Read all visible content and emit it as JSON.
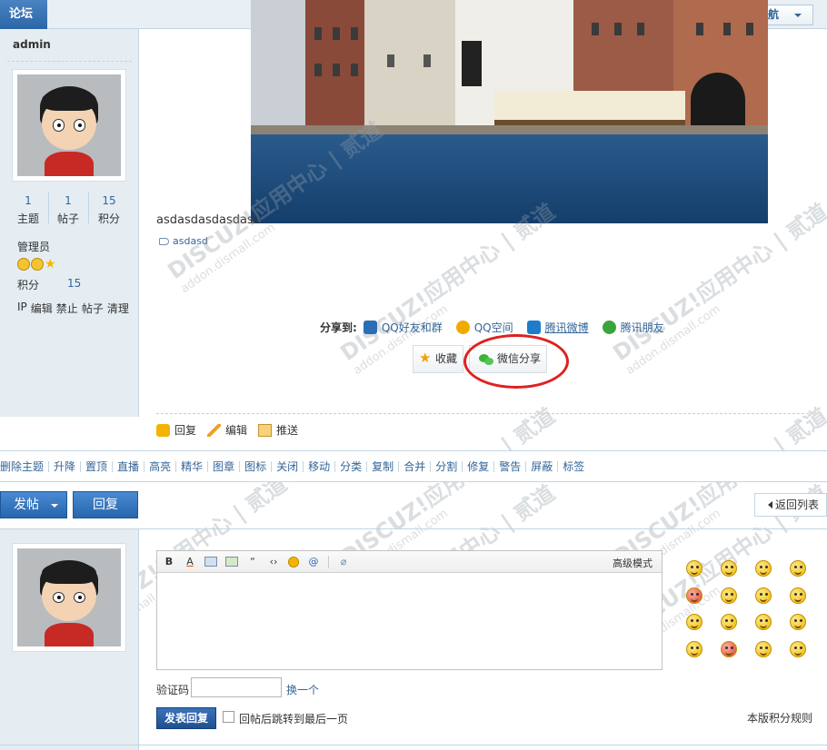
{
  "topbar": {
    "forum_tab": "论坛",
    "quick_nav": "快捷导航"
  },
  "user": {
    "name": "admin",
    "stats": [
      {
        "value": "1",
        "label": "主题"
      },
      {
        "value": "1",
        "label": "帖子"
      },
      {
        "value": "15",
        "label": "积分"
      }
    ],
    "group": "管理员",
    "points_label": "积分",
    "points_value": "15",
    "admin_links": [
      "IP",
      "编辑",
      "禁止",
      "帖子",
      "清理"
    ]
  },
  "post": {
    "text": "asdasdasdasdasd",
    "tag": "asdasd",
    "share": {
      "label": "分享到:",
      "items": [
        {
          "label": "QQ好友和群",
          "icon": "qq-icon",
          "color": "#2a6fb5"
        },
        {
          "label": "QQ空间",
          "icon": "qzone-icon",
          "color": "#f2a900"
        },
        {
          "label": "腾讯微博",
          "icon": "tencent-weibo-icon",
          "color": "#1d7dcc"
        },
        {
          "label": "腾讯朋友",
          "icon": "tencent-friend-icon",
          "color": "#3aa53a"
        }
      ]
    },
    "favorite": "收藏",
    "wechat_share": "微信分享",
    "actions": [
      "回复",
      "编辑",
      "推送"
    ]
  },
  "modbar": [
    "删除主题",
    "升降",
    "置顶",
    "直播",
    "高亮",
    "精华",
    "图章",
    "图标",
    "关闭",
    "移动",
    "分类",
    "复制",
    "合并",
    "分割",
    "修复",
    "警告",
    "屏蔽",
    "标签"
  ],
  "buttons": {
    "post": "发帖",
    "reply": "回复",
    "back": "返回列表"
  },
  "editor": {
    "toolbar_tools": [
      "B",
      "A",
      "image-icon",
      "link-icon",
      "quote-icon",
      "code-icon",
      "smiley-icon",
      "at-icon",
      "attach-icon"
    ],
    "advanced_mode": "高级模式",
    "captcha_label": "验证码",
    "captcha_value": "",
    "change_captcha": "换一个",
    "submit": "发表回复",
    "jump_label": "回帖后跳转到最后一页",
    "rules": "本版积分规则"
  },
  "watermark": {
    "brand": "DISCUZ!应用中心 | 贰道",
    "url": "addon.dismall.com"
  }
}
